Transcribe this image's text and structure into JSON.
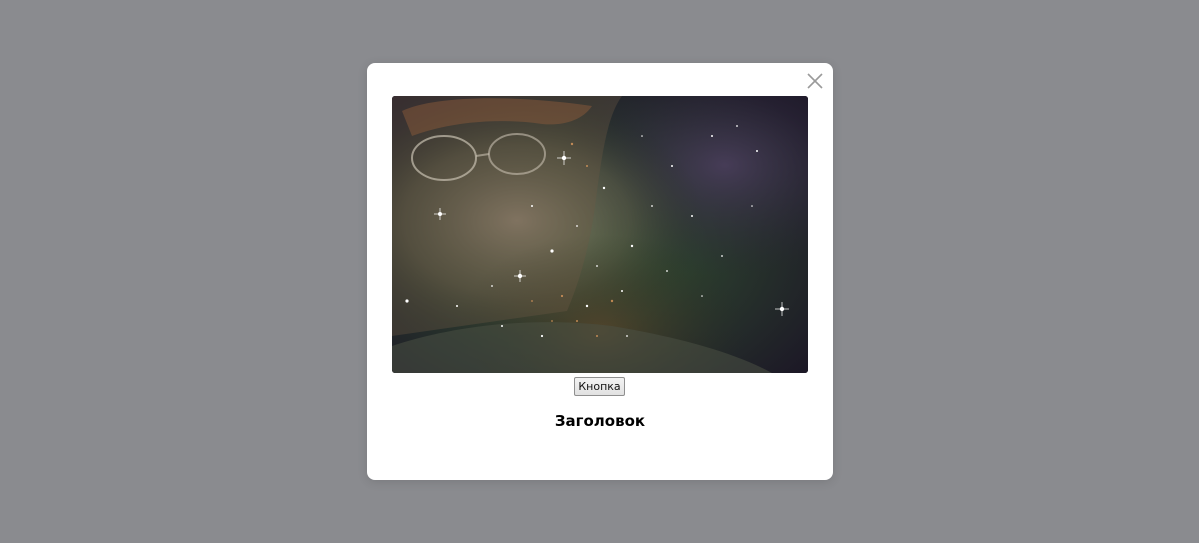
{
  "modal": {
    "close_icon": "close-icon",
    "image_alt": "",
    "button_label": "Кнопка",
    "title": "Заголовок"
  },
  "colors": {
    "backdrop": "#8a8b8f",
    "modal_background": "#ffffff",
    "close_icon": "#9a9a9a"
  }
}
